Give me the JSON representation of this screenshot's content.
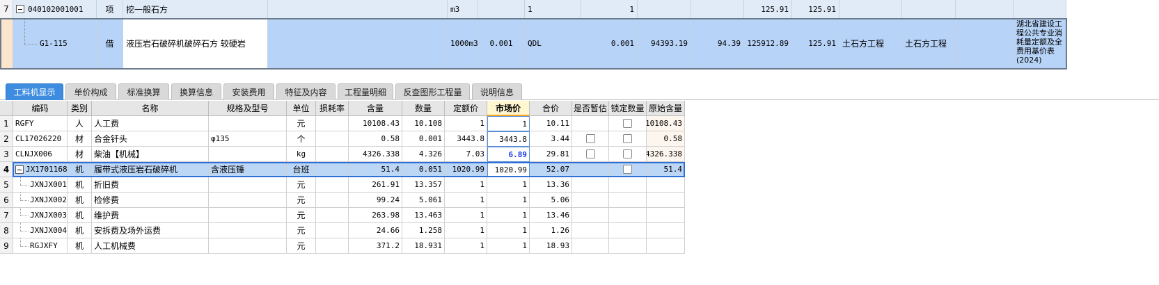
{
  "top_table": {
    "row7": {
      "num": "7",
      "code": "040102001001",
      "type": "项",
      "name": "挖一般石方",
      "unit": "m3",
      "qty_expr": "1",
      "qty": "1",
      "price": "125.91",
      "total": "125.91"
    },
    "row_selected": {
      "num": "",
      "code": "G1-115",
      "type": "借",
      "name": "液压岩石破碎机破碎石方 较硬岩",
      "unit": "1000m3",
      "content": "0.001",
      "qty_expr": "QDL",
      "qty": "0.001",
      "unit_price": "94393.19",
      "labor": "94.39",
      "composite_price": "125912.89",
      "total": "125.91",
      "category1": "土石方工程",
      "category2": "土石方工程",
      "source": "湖北省建设工程公共专业消耗量定额及全费用基价表(2024)"
    }
  },
  "tabs": [
    {
      "label": "工料机显示",
      "active": true
    },
    {
      "label": "单价构成",
      "active": false
    },
    {
      "label": "标准换算",
      "active": false
    },
    {
      "label": "换算信息",
      "active": false
    },
    {
      "label": "安装费用",
      "active": false
    },
    {
      "label": "特征及内容",
      "active": false
    },
    {
      "label": "工程量明细",
      "active": false
    },
    {
      "label": "反查图形工程量",
      "active": false
    },
    {
      "label": "说明信息",
      "active": false
    }
  ],
  "resource_table": {
    "headers": {
      "code": "编码",
      "type": "类别",
      "name": "名称",
      "spec": "规格及型号",
      "unit": "单位",
      "loss": "损耗率",
      "content": "含量",
      "qty": "数量",
      "quota_price": "定额价",
      "market_price": "市场价",
      "total": "合价",
      "estimate": "是否暂估",
      "lock_qty": "锁定数量",
      "orig_content": "原始含量"
    },
    "rows": [
      {
        "num": "1",
        "code": "RGFY",
        "type": "人",
        "name": "人工费",
        "spec": "",
        "unit": "元",
        "loss": "",
        "content": "10108.43",
        "qty": "10.108",
        "quota_price": "1",
        "market_price": "1",
        "total": "10.11",
        "orig_content": "10108.43"
      },
      {
        "num": "2",
        "code": "CL17026220",
        "type": "材",
        "name": "合金钎头",
        "spec": "φ135",
        "unit": "个",
        "loss": "",
        "content": "0.58",
        "qty": "0.001",
        "quota_price": "3443.8",
        "market_price": "3443.8",
        "total": "3.44",
        "orig_content": "0.58"
      },
      {
        "num": "3",
        "code": "CLNJX006",
        "type": "材",
        "name": "柴油【机械】",
        "spec": "",
        "unit": "kg",
        "loss": "",
        "content": "4326.338",
        "qty": "4.326",
        "quota_price": "7.03",
        "market_price": "6.89",
        "total": "29.81",
        "orig_content": "4326.338"
      },
      {
        "num": "4",
        "code": "JX17011680",
        "type": "机",
        "name": "履带式液压岩石破碎机",
        "spec": "含液压锤",
        "unit": "台班",
        "loss": "",
        "content": "51.4",
        "qty": "0.051",
        "quota_price": "1020.99",
        "market_price": "1020.99",
        "total": "52.07",
        "orig_content": "51.4"
      },
      {
        "num": "5",
        "code": "JXNJX001",
        "type": "机",
        "name": "折旧费",
        "spec": "",
        "unit": "元",
        "loss": "",
        "content": "261.91",
        "qty": "13.357",
        "quota_price": "1",
        "market_price": "1",
        "total": "13.36",
        "orig_content": ""
      },
      {
        "num": "6",
        "code": "JXNJX002",
        "type": "机",
        "name": "检修费",
        "spec": "",
        "unit": "元",
        "loss": "",
        "content": "99.24",
        "qty": "5.061",
        "quota_price": "1",
        "market_price": "1",
        "total": "5.06",
        "orig_content": ""
      },
      {
        "num": "7",
        "code": "JXNJX003",
        "type": "机",
        "name": "维护费",
        "spec": "",
        "unit": "元",
        "loss": "",
        "content": "263.98",
        "qty": "13.463",
        "quota_price": "1",
        "market_price": "1",
        "total": "13.46",
        "orig_content": ""
      },
      {
        "num": "8",
        "code": "JXNJX004",
        "type": "机",
        "name": "安拆费及场外运费",
        "spec": "",
        "unit": "元",
        "loss": "",
        "content": "24.66",
        "qty": "1.258",
        "quota_price": "1",
        "market_price": "1",
        "total": "1.26",
        "orig_content": ""
      },
      {
        "num": "9",
        "code": "RGJXFY",
        "type": "机",
        "name": "人工机械费",
        "spec": "",
        "unit": "元",
        "loss": "",
        "content": "371.2",
        "qty": "18.931",
        "quota_price": "1",
        "market_price": "1",
        "total": "18.93",
        "orig_content": ""
      }
    ]
  },
  "colors": {
    "tab_active": "#3d8ce0",
    "row_selected": "#b7d3f7",
    "market_price_changed": "#1838e8"
  }
}
